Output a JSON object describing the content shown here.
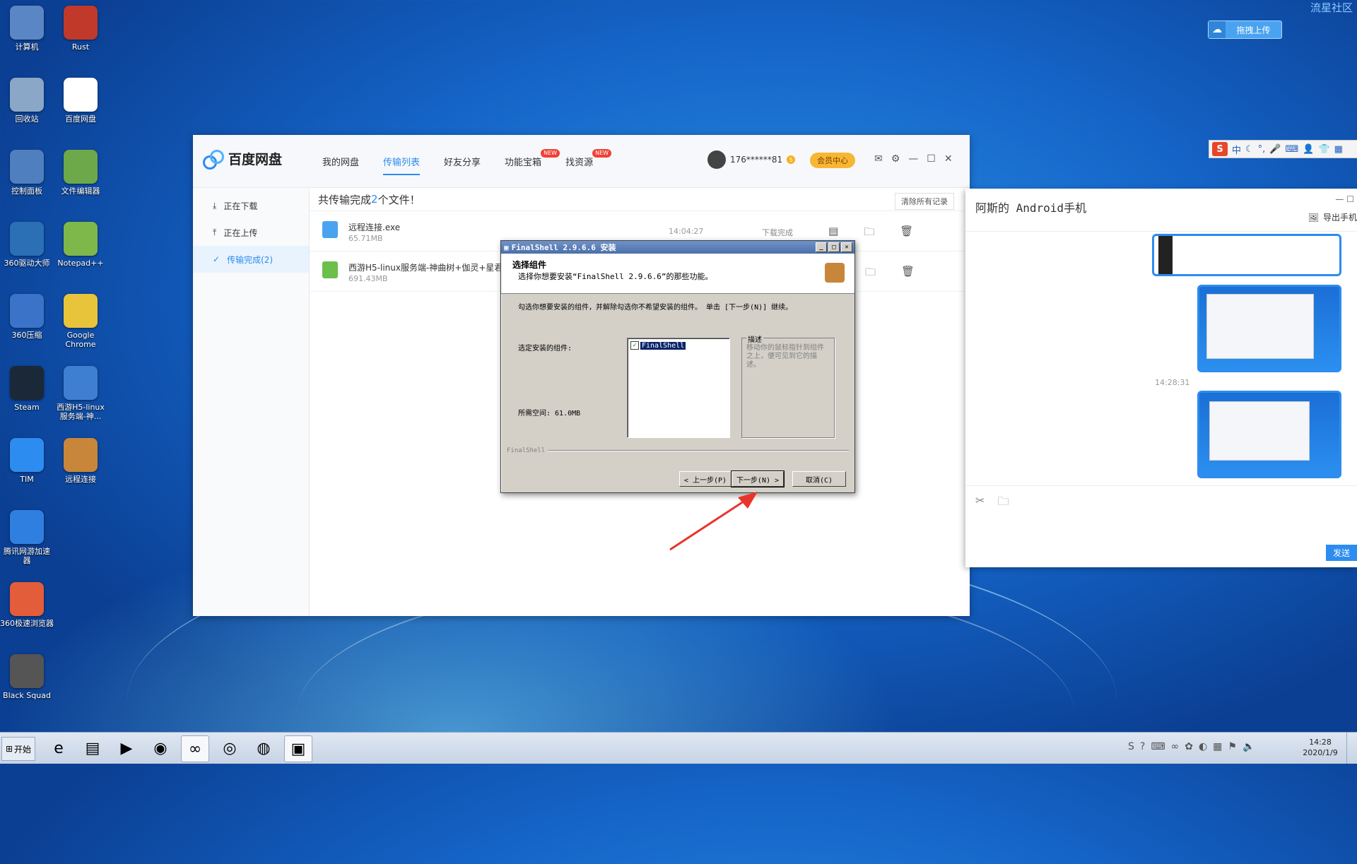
{
  "desktop": {
    "watermark": "流星社区",
    "drag_upload": "拖拽上传",
    "icons": [
      {
        "label": "计算机",
        "icon": "computer-icon",
        "color": "#5b86c6"
      },
      {
        "label": "Rust",
        "icon": "rust-icon",
        "color": "#c0392b"
      },
      {
        "label": "回收站",
        "icon": "recycle-bin-icon",
        "color": "#8aa7c8"
      },
      {
        "label": "百度网盘",
        "icon": "baidu-netdisk-icon",
        "color": "#ffffff"
      },
      {
        "label": "控制面板",
        "icon": "control-panel-icon",
        "color": "#4f7fbf"
      },
      {
        "label": "文件编辑器",
        "icon": "file-editor-icon",
        "color": "#6da84a"
      },
      {
        "label": "360驱动大师",
        "icon": "driver-master-icon",
        "color": "#2b6fb5"
      },
      {
        "label": "Notepad++",
        "icon": "notepad-plus-icon",
        "color": "#7fb84a"
      },
      {
        "label": "360压缩",
        "icon": "zip-icon",
        "color": "#3b73c9"
      },
      {
        "label": "Google Chrome",
        "icon": "chrome-icon",
        "color": "#e8c43b"
      },
      {
        "label": "Steam",
        "icon": "steam-icon",
        "color": "#1b2838"
      },
      {
        "label": "西游H5-linux服务端-神...",
        "icon": "archive-icon",
        "color": "#3f7fd1"
      },
      {
        "label": "TIM",
        "icon": "tim-icon",
        "color": "#2d8cf0"
      },
      {
        "label": "远程连接",
        "icon": "remote-icon",
        "color": "#c8863a"
      },
      {
        "label": "腾讯网游加速器",
        "icon": "accelerator-icon",
        "color": "#2f7fe0"
      },
      {
        "label": "360极速浏览器",
        "icon": "browser-360-icon",
        "color": "#e35d3b"
      },
      {
        "label": "Black Squad",
        "icon": "game-icon",
        "color": "#555555"
      }
    ]
  },
  "ime": {
    "logo": "S",
    "mode": "中"
  },
  "baidu": {
    "logo": "百度网盘",
    "nav": [
      {
        "label": "我的网盘",
        "active": false,
        "new": false
      },
      {
        "label": "传输列表",
        "active": true,
        "new": false
      },
      {
        "label": "好友分享",
        "active": false,
        "new": false
      },
      {
        "label": "功能宝箱",
        "active": false,
        "new": true
      },
      {
        "label": "找资源",
        "active": false,
        "new": true
      }
    ],
    "new_badge": "NEW",
    "user": "176******81",
    "coin": "5",
    "vip": "会员中心",
    "side": [
      {
        "label": "正在下载",
        "icon": "download-icon",
        "active": false
      },
      {
        "label": "正在上传",
        "icon": "upload-icon",
        "active": false
      },
      {
        "label": "传输完成(2)",
        "icon": "check-circle-icon",
        "active": true
      }
    ],
    "head_prefix": "共传输完成",
    "head_num": "2",
    "head_suffix": "个文件！",
    "clear": "清除所有记录",
    "files": [
      {
        "name": "远程连接.exe",
        "size": "65.71MB",
        "time": "14:04:27",
        "status": "下载完成",
        "color": "#4aa3f0"
      },
      {
        "name": "西游H5-linux服务端-神曲树+伽灵+星君",
        "size": "691.43MB",
        "time": "",
        "status": "",
        "color": "#6cbf4a"
      }
    ]
  },
  "installer": {
    "title": "FinalShell 2.9.6.6 安装",
    "heading": "选择组件",
    "subheading": "选择你想要安装“FinalShell 2.9.6.6”的那些功能。",
    "intro": "勾选你想要安装的组件，并解除勾选你不希望安装的组件。 单击 [下一步(N)] 继续。",
    "select_label": "选定安装的组件:",
    "space_label": "所需空间: 61.0MB",
    "component": "FinalShell",
    "desc_title": "描述",
    "desc_text": "移动你的鼠标指针到组件之上，便可见到它的描述。",
    "brand": "FinalShell",
    "back": "< 上一步(P)",
    "next": "下一步(N) >",
    "cancel": "取消(C)"
  },
  "phone": {
    "title": "阿斯的 Android手机",
    "export": "导出手机",
    "time": "14:28:31",
    "send": "发送"
  },
  "taskbar": {
    "start": "开始",
    "apps": [
      {
        "icon": "ie-icon",
        "glyph": "e",
        "active": false
      },
      {
        "icon": "explorer-icon",
        "glyph": "▤",
        "active": false
      },
      {
        "icon": "media-player-icon",
        "glyph": "▶",
        "active": false
      },
      {
        "icon": "browser-360-icon",
        "glyph": "◉",
        "active": false
      },
      {
        "icon": "baidu-netdisk-icon",
        "glyph": "∞",
        "active": true
      },
      {
        "icon": "chrome-icon",
        "glyph": "◎",
        "active": false
      },
      {
        "icon": "game-icon",
        "glyph": "◍",
        "active": false
      },
      {
        "icon": "installer-icon",
        "glyph": "▣",
        "active": true
      }
    ],
    "time": "14:28",
    "date": "2020/1/9"
  }
}
